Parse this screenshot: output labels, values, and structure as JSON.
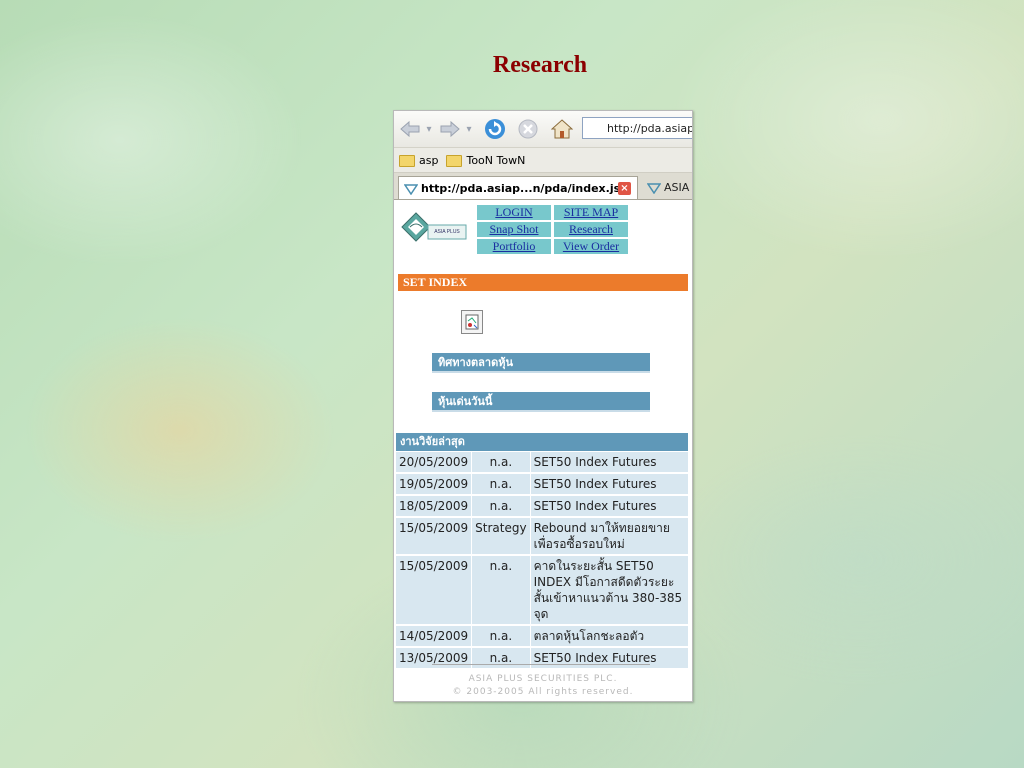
{
  "slide": {
    "title": "Research"
  },
  "browser": {
    "url": "http://pda.asiaplus",
    "bookmarks": [
      "asp",
      "TooN TowN"
    ],
    "tabs": [
      {
        "label": "http://pda.asiap...n/pda/index.jsp",
        "active": true
      },
      {
        "label": "ASIA",
        "active": false
      }
    ]
  },
  "page": {
    "logo_text": "ASIA PLUS",
    "nav": [
      [
        "LOGIN",
        "SITE MAP"
      ],
      [
        "Snap Shot",
        "Research"
      ],
      [
        "Portfolio",
        "View Order"
      ]
    ],
    "set_index_title": "SET INDEX",
    "chart_icon": "broken-image-icon",
    "sections": [
      "ทิศทางตลาดหุ้น",
      "หุ้นเด่นวันนี้"
    ],
    "research": {
      "header": "งานวิจัยล่าสุด",
      "rows": [
        {
          "date": "20/05/2009",
          "category": "n.a.",
          "title": "SET50 Index Futures"
        },
        {
          "date": "19/05/2009",
          "category": "n.a.",
          "title": "SET50 Index Futures"
        },
        {
          "date": "18/05/2009",
          "category": "n.a.",
          "title": "SET50 Index Futures"
        },
        {
          "date": "15/05/2009",
          "category": "Strategy",
          "title": "Rebound มาให้ทยอยขาย เพื่อรอซื้อรอบใหม่"
        },
        {
          "date": "15/05/2009",
          "category": "n.a.",
          "title": "คาดในระยะสั้น SET50 INDEX มีโอกาสดีดตัวระยะสั้นเข้าหาแนวต้าน 380-385 จุด"
        },
        {
          "date": "14/05/2009",
          "category": "n.a.",
          "title": "ตลาดหุ้นโลกชะลอตัว"
        },
        {
          "date": "13/05/2009",
          "category": "n.a.",
          "title": "SET50 Index Futures"
        }
      ]
    },
    "footer": {
      "company": "ASIA PLUS SECURITIES PLC.",
      "copyright": "© 2003-2005 All rights reserved."
    }
  },
  "colors": {
    "title": "#8b0000",
    "set_index_bar": "#ec7b2b",
    "section_bar": "#5f98b8",
    "nav_cell": "#78c8cc",
    "row_bg": "#d8e7f0"
  }
}
